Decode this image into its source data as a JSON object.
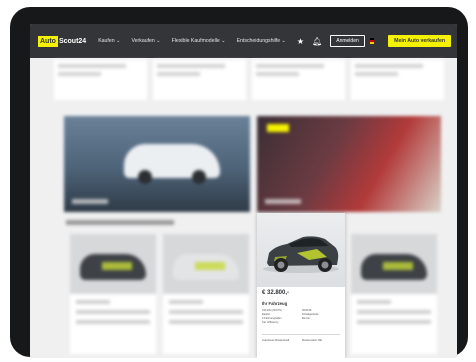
{
  "header": {
    "logo_auto": "Auto",
    "logo_scout": "Scout24",
    "menu": [
      "Kaufen",
      "Verkaufen",
      "Flexible Kaufmodelle",
      "Entscheidungshilfe"
    ],
    "login_label": "Anmelden",
    "sell_label": "Mein Auto verkaufen",
    "flag_colors": [
      "#000000",
      "#dd0000",
      "#ffce00"
    ],
    "icons": [
      "star-icon",
      "bell-icon"
    ]
  },
  "featured_listing": {
    "price": "€ 32.800,-",
    "vehicle_type": "Ihr Fahrzeug",
    "specs_left": [
      "150 kW (204 PS)",
      "Elektro",
      "3 Fahrzeughalter",
      "Kat. Efficiency"
    ],
    "specs_right": [
      "05/2019",
      "Schaltgetriebe",
      "Benzin"
    ],
    "seller": "Autohaus Musterstadt",
    "location": "Musterstadt, DE"
  },
  "colors": {
    "brand_yellow": "#f5f200",
    "header_bg": "#333538"
  }
}
